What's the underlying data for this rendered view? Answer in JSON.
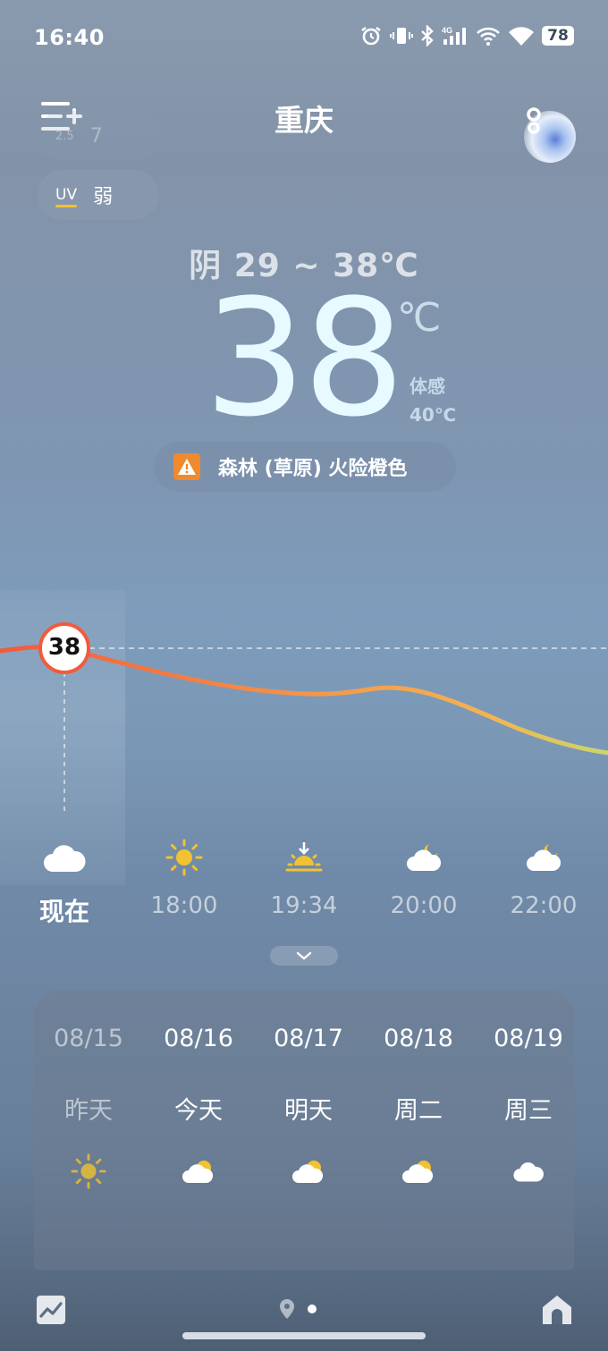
{
  "status_bar": {
    "time": "16:40",
    "network": "4G",
    "battery": "78",
    "icons": [
      "alarm-icon",
      "vibrate-icon",
      "bluetooth-icon",
      "cellular-signal-icon",
      "wifi-calling-icon",
      "wifi-icon",
      "battery-icon"
    ]
  },
  "header": {
    "city": "重庆",
    "menu_icon": "add-city-menu-icon",
    "assistant_icon": "assistant-orb-icon"
  },
  "chips": {
    "aqi_label": "2.5",
    "aqi_value": "7",
    "uv_label": "UV",
    "uv_value": "弱"
  },
  "current": {
    "summary": "阴  29 ~ 38℃",
    "temperature": "38",
    "unit": "℃",
    "feels_label": "体感",
    "feels_value": "40℃",
    "alert_text": "森林 (草原) 火险橙色",
    "alert_icon": "warning-triangle-icon",
    "alert_color": "#f08a2c"
  },
  "hourly": {
    "current_marker": "38",
    "items": [
      {
        "label": "现在",
        "icon": "cloud-icon"
      },
      {
        "label": "18:00",
        "icon": "sun-icon"
      },
      {
        "label": "19:34",
        "icon": "sunset-icon"
      },
      {
        "label": "20:00",
        "icon": "cloud-moon-icon"
      },
      {
        "label": "22:00",
        "icon": "cloud-moon-icon"
      }
    ],
    "expand_icon": "chevron-down-icon"
  },
  "daily": [
    {
      "date": "08/15",
      "name": "昨天",
      "icon": "sun-icon"
    },
    {
      "date": "08/16",
      "name": "今天",
      "icon": "cloud-sun-icon"
    },
    {
      "date": "08/17",
      "name": "明天",
      "icon": "cloud-sun-icon"
    },
    {
      "date": "08/18",
      "name": "周二",
      "icon": "cloud-sun-icon"
    },
    {
      "date": "08/19",
      "name": "周三",
      "icon": "cloud-icon"
    }
  ],
  "bottom_nav": {
    "left_icon": "trend-chart-icon",
    "center_icon": "location-pin-icon",
    "right_icon": "home-icon"
  },
  "colors": {
    "sun": "#f2c230",
    "curve_start": "#f25a3c",
    "curve_mid": "#f59a4a",
    "curve_end": "#cbd86a"
  }
}
